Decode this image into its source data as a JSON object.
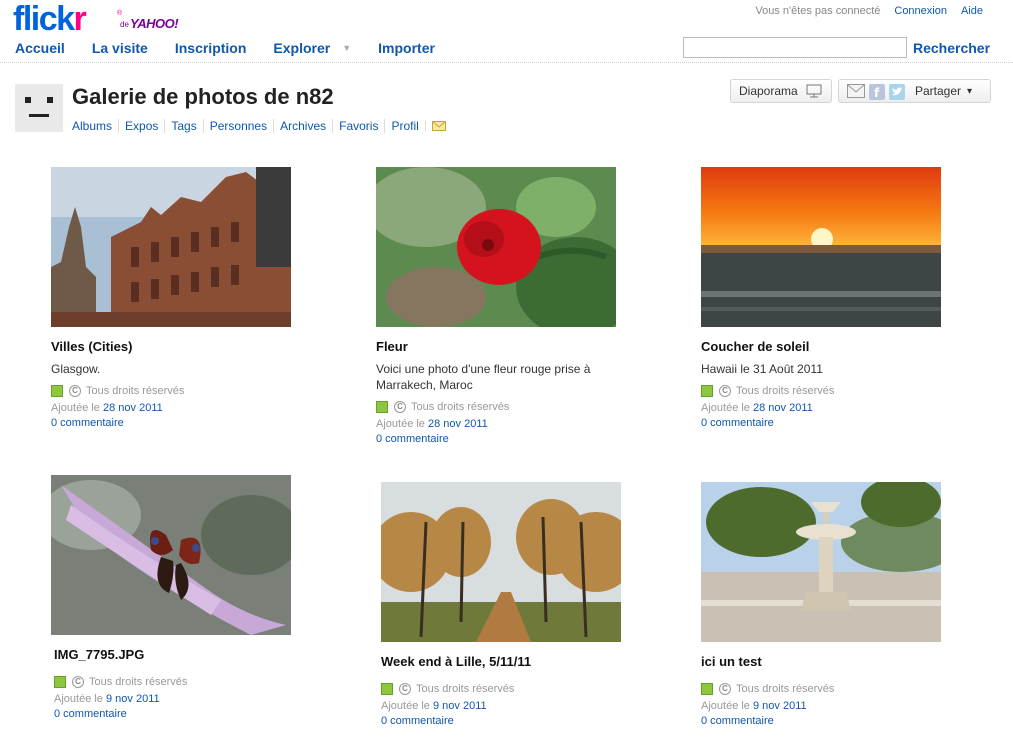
{
  "brand": {
    "name_part1": "flick",
    "name_part2": "r",
    "reg": "®",
    "de": "de",
    "yahoo": "YAHOO!"
  },
  "topbar": {
    "status": "Vous n'êtes pas connecté",
    "login": "Connexion",
    "help": "Aide"
  },
  "nav": {
    "home": "Accueil",
    "tour": "La visite",
    "signup": "Inscription",
    "explore": "Explorer",
    "explore_caret": "▼",
    "upload": "Importer"
  },
  "search": {
    "value": "",
    "button": "Rechercher"
  },
  "gallery": {
    "title": "Galerie de photos de n82",
    "subnav": [
      "Albums",
      "Expos",
      "Tags",
      "Personnes",
      "Archives",
      "Favoris",
      "Profil"
    ],
    "slideshow": "Diaporama",
    "share": "Partager",
    "share_caret": "▾"
  },
  "photos": [
    {
      "title": "Villes (Cities)",
      "desc": "Glasgow.",
      "license": "Tous droits réservés",
      "added_prefix": "Ajoutée le",
      "added_date": "28 nov 2011",
      "comments": "0 commentaire"
    },
    {
      "title": "Fleur",
      "desc": "Voici une photo d'une fleur rouge prise à Marrakech, Maroc",
      "license": "Tous droits réservés",
      "added_prefix": "Ajoutée le",
      "added_date": "28 nov 2011",
      "comments": "0 commentaire"
    },
    {
      "title": "Coucher de soleil",
      "desc": "Hawaii le 31 Août 2011",
      "license": "Tous droits réservés",
      "added_prefix": "Ajoutée le",
      "added_date": "28 nov 2011",
      "comments": "0 commentaire"
    },
    {
      "title": "IMG_7795.JPG",
      "desc": "",
      "license": "Tous droits réservés",
      "added_prefix": "Ajoutée le",
      "added_date": "9 nov 2011",
      "comments": "0 commentaire"
    },
    {
      "title": "Week end à Lille, 5/11/11",
      "desc": "",
      "license": "Tous droits réservés",
      "added_prefix": "Ajoutée le",
      "added_date": "9 nov 2011",
      "comments": "0 commentaire"
    },
    {
      "title": "ici un test",
      "desc": "",
      "license": "Tous droits réservés",
      "added_prefix": "Ajoutée le",
      "added_date": "9 nov 2011",
      "comments": "0 commentaire"
    }
  ]
}
